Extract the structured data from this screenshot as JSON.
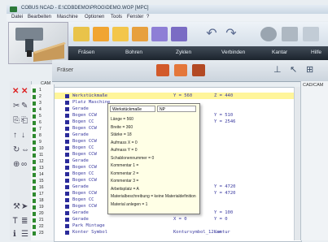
{
  "window": {
    "title": "COBUS NCAD - E:\\CDBDEMO\\PROG\\DEMO.WOP [MPC]"
  },
  "menu": [
    "Datei",
    "Bearbeiten",
    "Maschine",
    "Optionen",
    "Tools",
    "Fenster",
    "?"
  ],
  "tabs": [
    "Fräsen",
    "Bohren",
    "Zyklen",
    "Verbinden",
    "Kantar",
    "Hilfe"
  ],
  "mode": {
    "label": "Fräser"
  },
  "line_panel": {
    "header": "CAM",
    "rows": [
      "1",
      "2",
      "3",
      "4",
      "5",
      "6",
      "7",
      "8",
      "9",
      "10",
      "11",
      "12",
      "13",
      "14",
      "15",
      "16",
      "17",
      "18",
      "19",
      "20",
      "21",
      "22",
      "23"
    ]
  },
  "cadcam": {
    "label": "CAD/CAM"
  },
  "code": [
    {
      "t": "Werkstückmaße",
      "p2": "Y = 560",
      "p3": "Z = 440",
      "hl": true
    },
    {
      "t": "Platz Maschine",
      "p2": "",
      "p3": ""
    },
    {
      "t": "Gerade",
      "p2": "",
      "p3": ""
    },
    {
      "t": "Bogen CCW",
      "p2": "",
      "p3": "Y = 510"
    },
    {
      "t": "Bogen CC",
      "p2": "",
      "p3": "Y = 2546"
    },
    {
      "t": "Bogen CCW",
      "p2": "",
      "p3": ""
    },
    {
      "t": "Gerade",
      "p2": "",
      "p3": ""
    },
    {
      "t": "Bogen CCW",
      "p2": "",
      "p3": ""
    },
    {
      "t": "Bogen CC",
      "p2": "",
      "p3": ""
    },
    {
      "t": "Bogen CCW",
      "p2": "",
      "p3": ""
    },
    {
      "t": "Gerade",
      "p2": "",
      "p3": ""
    },
    {
      "t": "Bogen CCW",
      "p2": "",
      "p3": ""
    },
    {
      "t": "Bogen CC",
      "p2": "",
      "p3": ""
    },
    {
      "t": "Bogen CCW",
      "p2": "",
      "p3": ""
    },
    {
      "t": "Gerade",
      "p2": "",
      "p3": "Y = 4720"
    },
    {
      "t": "Bogen CCW",
      "p2": "",
      "p3": "Y = 4720"
    },
    {
      "t": "Bogen CC",
      "p2": "",
      "p3": ""
    },
    {
      "t": "Bogen CCW",
      "p2": "",
      "p3": ""
    },
    {
      "t": "Gerade",
      "p2": "X = 0",
      "p3": "Y = 100"
    },
    {
      "t": "Gerade",
      "p2": "X = 0",
      "p3": "Y = 0"
    },
    {
      "t": "Park Mintage",
      "p2": "",
      "p3": ""
    },
    {
      "t": "Konter Symbol",
      "p2": "Kontursymbol_12.sm",
      "p3": "Kontur"
    }
  ],
  "tooltip": {
    "name": "Werkstückmaße",
    "np": "NP",
    "rows": [
      "Länge = 560",
      "Breite = 360",
      "Stärke = 18",
      "Aufmass X = 0",
      "Aufmass Y = 0",
      "Schablonennummer = 0",
      "Kommentar 1 =",
      "Kommentar 2 =",
      "Kommentar 3 =",
      "Arbeitsplatz = A",
      "Materialbeschreibung = keine Materialdefinition",
      "Material anlegen = 1"
    ]
  },
  "colors": {
    "accent": "#2f8a2f",
    "tabbar": "#1c242d",
    "highlight": "#fff59a",
    "tooltip": "#ffffe6"
  }
}
